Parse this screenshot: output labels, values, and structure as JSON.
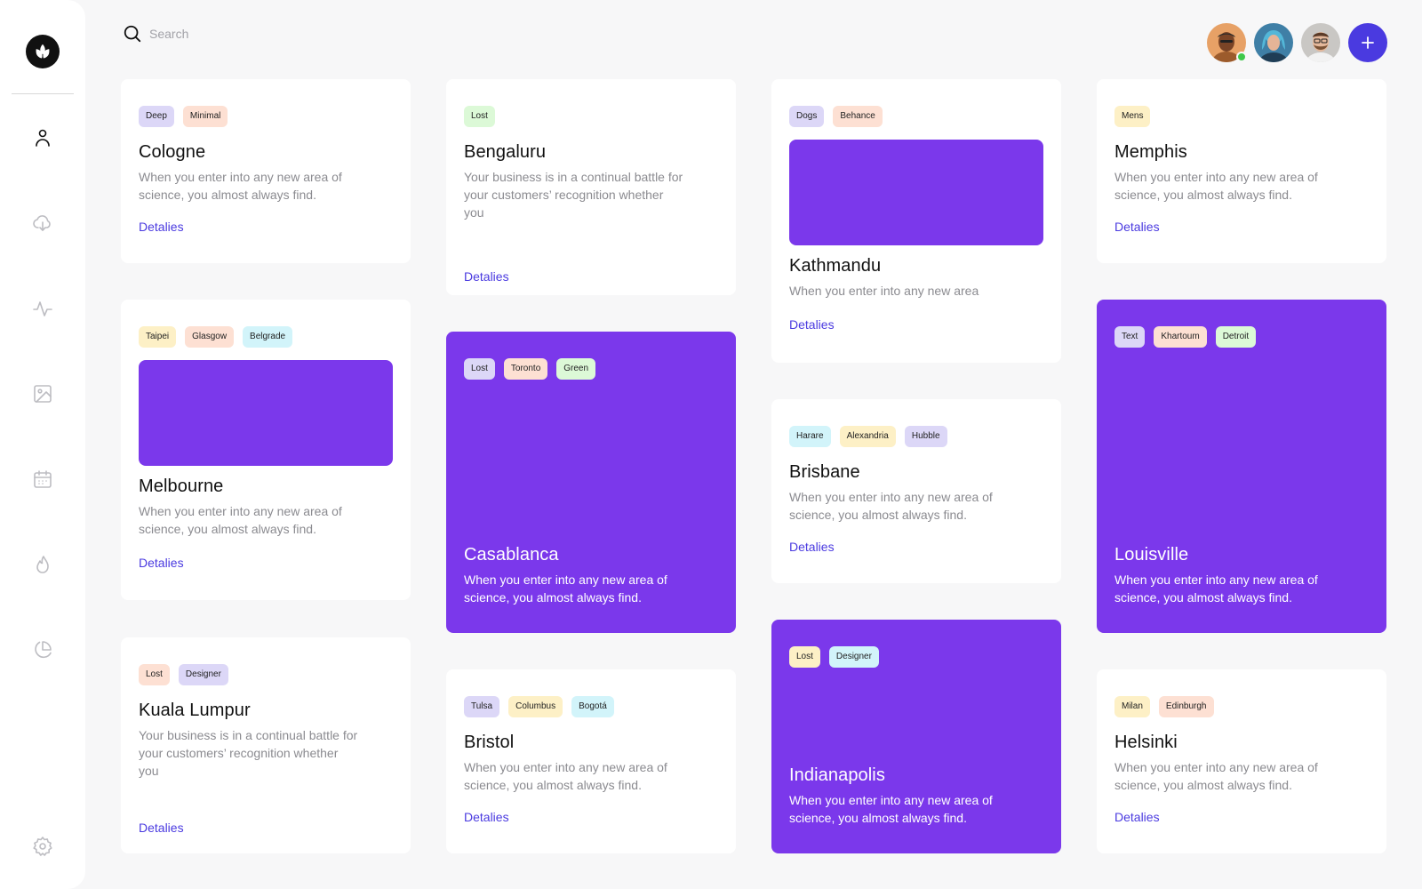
{
  "sidebar": {
    "logo_icon": "leaf-logo",
    "items": [
      {
        "icon": "user-icon",
        "active": true
      },
      {
        "icon": "cloud-download-icon",
        "active": false
      },
      {
        "icon": "activity-icon",
        "active": false
      },
      {
        "icon": "image-icon",
        "active": false
      },
      {
        "icon": "calendar-icon",
        "active": false
      },
      {
        "icon": "flame-icon",
        "active": false
      },
      {
        "icon": "pie-chart-icon",
        "active": false
      }
    ],
    "settings_icon": "gear-icon"
  },
  "header": {
    "search_placeholder": "Search",
    "avatars": [
      "avatar-1",
      "avatar-2",
      "avatar-3"
    ],
    "online_status_color": "#3ec84a",
    "add_button_icon": "plus-icon"
  },
  "colors": {
    "accent": "#4a3ae0",
    "card_purple": "#7b38eb"
  },
  "cards": {
    "cologne": {
      "tags": [
        "Deep",
        "Minimal"
      ],
      "title": "Cologne",
      "desc": "When you enter into any new area of science, you almost always find.",
      "link": "Detalies"
    },
    "melbourne": {
      "tags": [
        "Taipei",
        "Glasgow",
        "Belgrade"
      ],
      "title": "Melbourne",
      "desc": "When you enter into any new area of science, you almost always find.",
      "link": "Detalies"
    },
    "kuala_lumpur": {
      "tags": [
        "Lost",
        "Designer"
      ],
      "title": "Kuala Lumpur",
      "desc": "Your business is in a continual battle for your customers’ recognition whether you",
      "link": "Detalies"
    },
    "bengaluru": {
      "tags": [
        "Lost"
      ],
      "title": "Bengaluru",
      "desc": "Your business is in a continual battle for your customers’ recognition whether you",
      "link": "Detalies"
    },
    "casablanca": {
      "tags": [
        "Lost",
        "Toronto",
        "Green"
      ],
      "title": "Casablanca",
      "desc": "When you enter into any new area of science, you almost always find."
    },
    "bristol": {
      "tags": [
        "Tulsa",
        "Columbus",
        "Bogotá"
      ],
      "title": "Bristol",
      "desc": "When you enter into any new area of science, you almost always find.",
      "link": "Detalies"
    },
    "kathmandu": {
      "tags": [
        "Dogs",
        "Behance"
      ],
      "title": "Kathmandu",
      "desc": "When you enter into any new area",
      "link": "Detalies"
    },
    "brisbane": {
      "tags": [
        "Harare",
        "Alexandria",
        "Hubble"
      ],
      "title": "Brisbane",
      "desc": "When you enter into any new area of science, you almost always find.",
      "link": "Detalies"
    },
    "indianapolis": {
      "tags": [
        "Lost",
        "Designer"
      ],
      "title": "Indianapolis",
      "desc": "When you enter into any new area of science, you almost always find."
    },
    "memphis": {
      "tags": [
        "Mens"
      ],
      "title": "Memphis",
      "desc": "When you enter into any new area of science, you almost always find.",
      "link": "Detalies"
    },
    "louisville": {
      "tags": [
        "Text",
        "Khartoum",
        "Detroit"
      ],
      "title": "Louisville",
      "desc": "When you enter into any new area of science, you almost always find."
    },
    "helsinki": {
      "tags": [
        "Milan",
        "Edinburgh"
      ],
      "title": "Helsinki",
      "desc": "When you enter into any new area of science, you almost always find.",
      "link": "Detalies"
    }
  }
}
